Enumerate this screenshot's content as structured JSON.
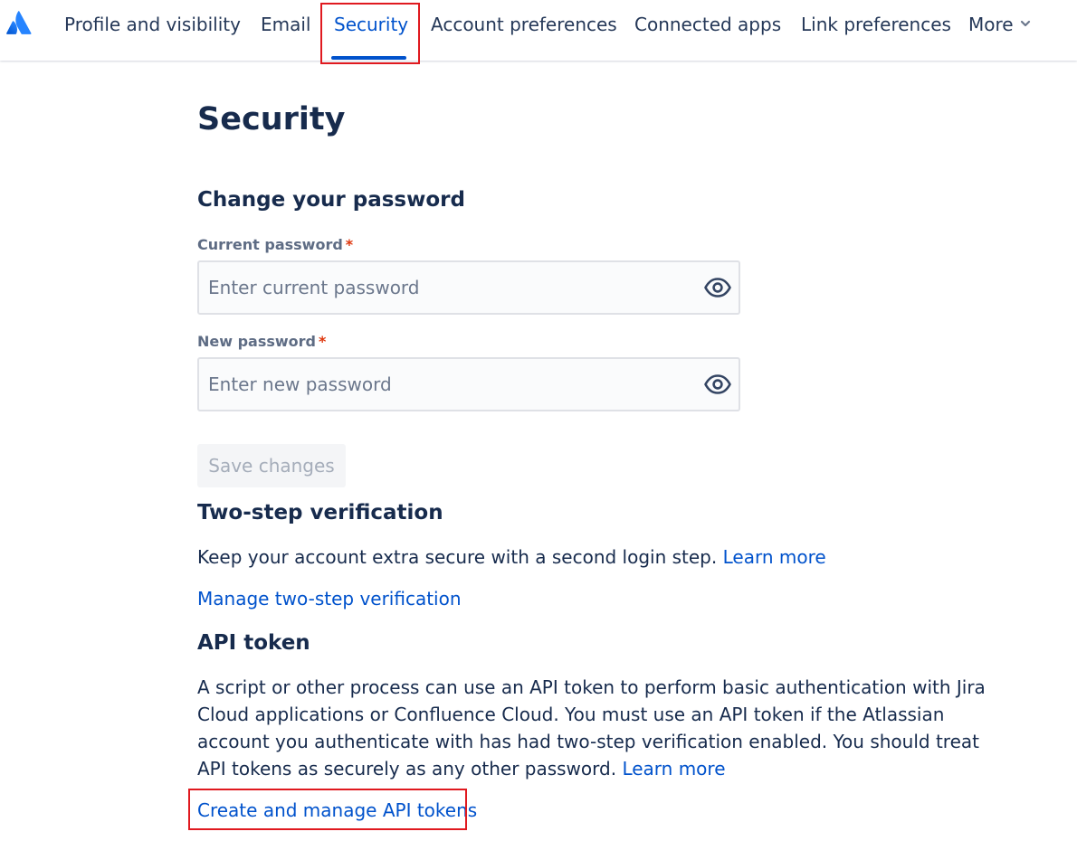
{
  "nav": {
    "logo_icon": "atlassian-logo-icon",
    "items": [
      {
        "label": "Profile and visibility"
      },
      {
        "label": "Email"
      },
      {
        "label": "Security"
      },
      {
        "label": "Account preferences"
      },
      {
        "label": "Connected apps"
      },
      {
        "label": "Link preferences"
      },
      {
        "label": "More"
      }
    ],
    "active_item": "Security",
    "more_icon": "chevron-down-icon"
  },
  "colors": {
    "primary_text": "#172b4d",
    "link": "#0052cc",
    "active_tab": "#0052cc",
    "required": "#de350b",
    "highlight_box": "#e0191f",
    "disabled_text": "#a5adba"
  },
  "page": {
    "title": "Security"
  },
  "password": {
    "heading": "Change your password",
    "current": {
      "label": "Current password",
      "required_mark": "*",
      "placeholder": "Enter current password",
      "value": "",
      "icon": "eye-icon"
    },
    "new": {
      "label": "New password",
      "required_mark": "*",
      "placeholder": "Enter new password",
      "value": "",
      "icon": "eye-icon"
    },
    "save_label": "Save changes"
  },
  "two_step": {
    "heading": "Two-step verification",
    "description": "Keep your account extra secure with a second login step.",
    "learn_more": "Learn more",
    "manage_link": "Manage two-step verification"
  },
  "api_token": {
    "heading": "API token",
    "description": "A script or other process can use an API token to perform basic authentication with Jira Cloud applications or Confluence Cloud. You must use an API token if the Atlassian account you authenticate with has had two-step verification enabled. You should treat API tokens as securely as any other password.",
    "learn_more": "Learn more",
    "manage_link": "Create and manage API tokens"
  }
}
